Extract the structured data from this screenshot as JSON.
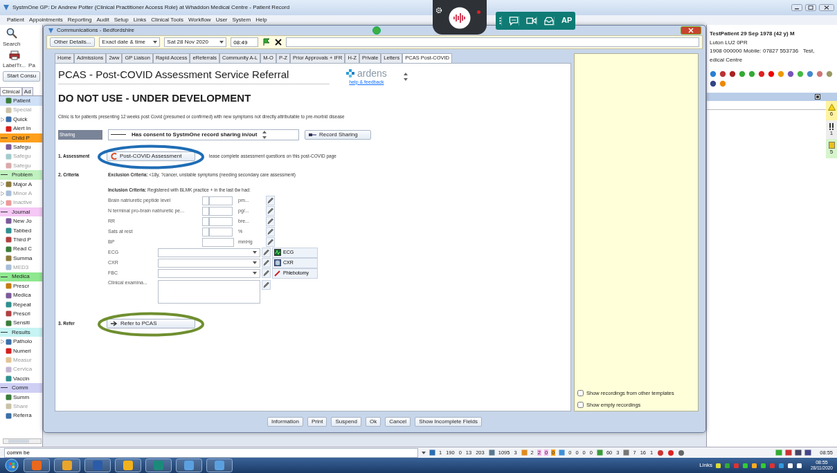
{
  "window": {
    "title": "SystmOne GP: Dr Andrew Potter (Clinical Practitioner Access Role) at Whaddon Medical Centre - Patient Record"
  },
  "menu": [
    "Patient",
    "Appointments",
    "Reporting",
    "Audit",
    "Setup",
    "Links",
    "Clinical Tools",
    "Workflow",
    "User",
    "System",
    "Help"
  ],
  "toolbar": [
    {
      "label": "Search",
      "kind": "search"
    },
    {
      "label": "LabelTr...",
      "kind": "printer"
    },
    {
      "label": "Pa",
      "kind": "plain"
    }
  ],
  "start_button": "Start Consu",
  "sidebar": {
    "tabs": [
      {
        "label": "Clinical",
        "selected": true
      },
      {
        "label": "Ad",
        "selected": false
      }
    ],
    "items": [
      {
        "label": "Patient",
        "kind": "item",
        "selected": true,
        "disabled": false,
        "expandable": false
      },
      {
        "label": "Special",
        "kind": "item",
        "selected": false,
        "disabled": true,
        "expandable": false
      },
      {
        "label": "Quick",
        "kind": "item",
        "selected": false,
        "disabled": false,
        "expandable": true
      },
      {
        "label": "Alert In",
        "kind": "item",
        "selected": false,
        "disabled": false,
        "expandable": false
      },
      {
        "label": "Child P",
        "kind": "header",
        "color": "#ff9f1c"
      },
      {
        "label": "Safegu",
        "kind": "item",
        "selected": false,
        "disabled": false,
        "expandable": false
      },
      {
        "label": "Safegu",
        "kind": "item",
        "selected": false,
        "disabled": true,
        "expandable": false
      },
      {
        "label": "Safegu",
        "kind": "item",
        "selected": false,
        "disabled": true,
        "expandable": false
      },
      {
        "label": "Problem",
        "kind": "header",
        "color": "#bff2bf"
      },
      {
        "label": "Major A",
        "kind": "item",
        "selected": false,
        "disabled": false,
        "expandable": true
      },
      {
        "label": "Minor A",
        "kind": "item",
        "selected": false,
        "disabled": true,
        "expandable": true
      },
      {
        "label": "Inactive",
        "kind": "item",
        "selected": false,
        "disabled": true,
        "expandable": true
      },
      {
        "label": "Journal",
        "kind": "header",
        "color": "#f5c8f5"
      },
      {
        "label": "New Jo",
        "kind": "item",
        "selected": false,
        "disabled": false,
        "expandable": false
      },
      {
        "label": "Tabbed",
        "kind": "item",
        "selected": false,
        "disabled": false,
        "expandable": false
      },
      {
        "label": "Third P",
        "kind": "item",
        "selected": false,
        "disabled": false,
        "expandable": false
      },
      {
        "label": "Read C",
        "kind": "item",
        "selected": false,
        "disabled": false,
        "expandable": false
      },
      {
        "label": "Summa",
        "kind": "item",
        "selected": false,
        "disabled": false,
        "expandable": false
      },
      {
        "label": "MED3",
        "kind": "item",
        "selected": false,
        "disabled": true,
        "expandable": false
      },
      {
        "label": "Medica",
        "kind": "header",
        "color": "#8fe88f"
      },
      {
        "label": "Prescr",
        "kind": "item",
        "selected": false,
        "disabled": false,
        "expandable": false
      },
      {
        "label": "Medica",
        "kind": "item",
        "selected": false,
        "disabled": false,
        "expandable": false
      },
      {
        "label": "Repeat",
        "kind": "item",
        "selected": false,
        "disabled": false,
        "expandable": false
      },
      {
        "label": "Prescri",
        "kind": "item",
        "selected": false,
        "disabled": false,
        "expandable": false
      },
      {
        "label": "Sensiti",
        "kind": "item",
        "selected": false,
        "disabled": false,
        "expandable": false
      },
      {
        "label": "Results",
        "kind": "header",
        "color": "#c6f3f3"
      },
      {
        "label": "Patholo",
        "kind": "item",
        "selected": false,
        "disabled": false,
        "expandable": true
      },
      {
        "label": "Numeri",
        "kind": "item",
        "selected": false,
        "disabled": false,
        "expandable": false
      },
      {
        "label": "Measur",
        "kind": "item",
        "selected": false,
        "disabled": true,
        "expandable": false
      },
      {
        "label": "Cervica",
        "kind": "item",
        "selected": false,
        "disabled": true,
        "expandable": false
      },
      {
        "label": "Vaccin",
        "kind": "item",
        "selected": false,
        "disabled": false,
        "expandable": false
      },
      {
        "label": "Comm",
        "kind": "header",
        "color": "#cfcff5"
      },
      {
        "label": "Summ",
        "kind": "item",
        "selected": false,
        "disabled": false,
        "expandable": false
      },
      {
        "label": "Share",
        "kind": "item",
        "selected": false,
        "disabled": true,
        "expandable": false
      },
      {
        "label": "Referra",
        "kind": "item",
        "selected": false,
        "disabled": false,
        "expandable": false
      }
    ]
  },
  "patient": {
    "name": "TestPatient 29 Sep 1978 (42 y) M",
    "lines": [
      "Luton LU2 0PR",
      "1908 000000 Mobile: 07827 553736   Test,",
      "edical Centre"
    ],
    "flags": [
      {
        "kind": "warning",
        "count": "6",
        "color": "#fff3a0"
      },
      {
        "kind": "alert",
        "count": "1",
        "color": "#eeeeee"
      },
      {
        "kind": "document",
        "count": "5",
        "color": "#d6f5cc"
      }
    ]
  },
  "call_widget": {
    "initials": "AP"
  },
  "dialog": {
    "title": "Communications - Bedfordshire",
    "other_details": "Other Details...",
    "date_mode": "Exact date & time",
    "date": "Sat 28 Nov 2020",
    "time": "08:49",
    "tabs": [
      {
        "label": "Home",
        "selected": false
      },
      {
        "label": "Admissions",
        "selected": false
      },
      {
        "label": "2ww",
        "selected": false
      },
      {
        "label": "GP Liaison",
        "selected": false
      },
      {
        "label": "Rapid Access",
        "selected": false
      },
      {
        "label": "eReferrals",
        "selected": false
      },
      {
        "label": "Community A-L",
        "selected": false
      },
      {
        "label": "M-O",
        "selected": false
      },
      {
        "label": "P-Z",
        "selected": false
      },
      {
        "label": "Prior Approvals + IFR",
        "selected": false
      },
      {
        "label": "H-Z",
        "selected": false
      },
      {
        "label": "Private",
        "selected": false
      },
      {
        "label": "Letters",
        "selected": false
      },
      {
        "label": "PCAS Post-COVID",
        "selected": true
      }
    ],
    "form": {
      "title": "PCAS - Post-COVID Assessment Service Referral",
      "logo": "ardens",
      "logo_link": "help & feedback",
      "warning": "DO NOT USE - UNDER DEVELOPMENT",
      "intro": "Clinic is for patients presenting 12 weeks post Covid (presumed or confirmed) with new symptoms not directly attributable to pre-morbid disease",
      "sharing": {
        "label": "Sharing",
        "value": "Has consent to SystmOne record sharing in/out",
        "button": "Record Sharing"
      },
      "assessment": {
        "label": "1. Assessment",
        "button": "Post-COVID Assessment",
        "note": "lease complete assessment questions on this post-COVID page",
        "color": "#1f6db5"
      },
      "criteria": {
        "label": "2. Criteria",
        "exclusion": "**Exclusion Criteria:** <18y, ?cancer, unstable symptoms (needing secondary care assessment)",
        "inclusion": "**Inclusion Criteria:** Registered with BLMK practice + in the last 6w had:",
        "fields": [
          {
            "kind": "numeric",
            "label": "Brain natriuretic peptide level",
            "unit": "pm..."
          },
          {
            "kind": "numeric",
            "label": "N terminal pro-brain natriuretic pe...",
            "unit": "pg/..."
          },
          {
            "kind": "numeric",
            "label": "RR",
            "unit": "bre..."
          },
          {
            "kind": "numeric",
            "label": "Sats at rest",
            "unit": "%"
          },
          {
            "kind": "single",
            "label": "BP",
            "unit": "mmHg"
          },
          {
            "kind": "select",
            "label": "ECG",
            "button": "ECG"
          },
          {
            "kind": "select",
            "label": "CXR",
            "button": "CXR"
          },
          {
            "kind": "select",
            "label": "FBC",
            "button": "Phlebotomy"
          },
          {
            "kind": "text",
            "label": "Clinical examina..."
          }
        ]
      },
      "refer": {
        "label": "3. Refer",
        "button": "Refer to PCAS",
        "color": "#6f8f2f"
      }
    },
    "options": [
      {
        "label": "Show recordings from other templates",
        "checked": false
      },
      {
        "label": "Show empty recordings",
        "checked": false
      }
    ],
    "buttons": [
      "Information",
      "Print",
      "Suspend",
      "Ok",
      "Cancel",
      "Show Incomplete Fields"
    ]
  },
  "status_bar": {
    "search": "comm be",
    "groups": [
      {
        "values": [
          {
            "text": "1"
          },
          {
            "text": "190"
          },
          {
            "text": "0"
          },
          {
            "text": "13"
          },
          {
            "text": "203"
          }
        ]
      },
      {
        "values": [
          {
            "text": "1095"
          },
          {
            "text": "3"
          }
        ]
      },
      {
        "values": [
          {
            "text": "2"
          },
          {
            "text": "2",
            "color": "#f9b8f0"
          },
          {
            "text": "0",
            "color": "#f9b8f0"
          },
          {
            "text": "0",
            "color": "#ffa31a"
          }
        ]
      },
      {
        "values": [
          {
            "text": "0"
          },
          {
            "text": "0"
          },
          {
            "text": "0"
          },
          {
            "text": "0"
          }
        ]
      },
      {
        "values": [
          {
            "text": "60"
          },
          {
            "text": "3"
          }
        ]
      },
      {
        "values": [
          {
            "text": "7"
          },
          {
            "text": "16"
          },
          {
            "text": "1"
          }
        ]
      }
    ],
    "time": "08:55"
  },
  "taskbar": {
    "links": "Links",
    "time": "08:55",
    "date": "28/11/2020"
  }
}
